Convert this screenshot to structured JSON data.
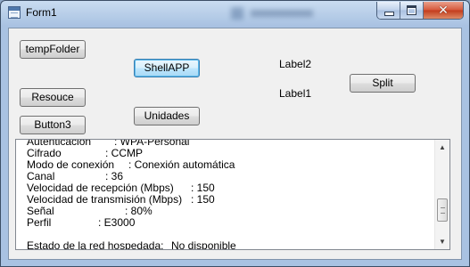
{
  "window": {
    "title": "Form1",
    "controls": {
      "minimize": "minimize",
      "maximize": "maximize",
      "close": "✕"
    }
  },
  "buttons": {
    "temp_folder": "tempFolder",
    "resource": "Resouce",
    "button3": "Button3",
    "shell_app": "ShellAPP",
    "unidades": "Unidades",
    "split": "Split"
  },
  "labels": {
    "label1": "Label1",
    "label2": "Label2"
  },
  "output": {
    "lines": [
      [
        "Autenticación",
        ": WPA-Personal"
      ],
      [
        "Cifrado",
        ": CCMP"
      ],
      [
        "Modo de conexión",
        ": Conexión automática"
      ],
      [
        "Canal",
        ": 36"
      ],
      [
        "Velocidad de recepción (Mbps)",
        ": 150"
      ],
      [
        "Velocidad de transmisión (Mbps)",
        ": 150"
      ],
      [
        "Señal",
        ": 80%"
      ],
      [
        "Perfil",
        ": E3000"
      ],
      [
        "",
        ""
      ],
      [
        "Estado de la red hospedada:",
        "No disponible"
      ]
    ],
    "scrollbar": {
      "up_icon": "▲",
      "down_icon": "▼"
    }
  }
}
